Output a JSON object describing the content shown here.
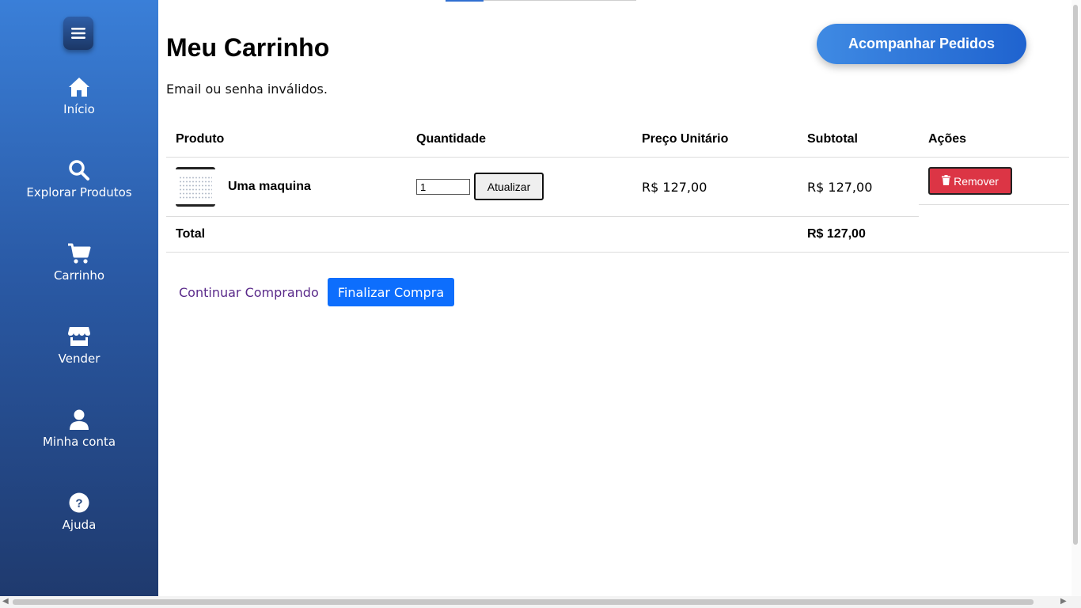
{
  "sidebar": {
    "menu_icon": "hamburger-menu-icon",
    "items": [
      {
        "label": "Início",
        "icon": "home-icon"
      },
      {
        "label": "Explorar Produtos",
        "icon": "search-icon"
      },
      {
        "label": "Carrinho",
        "icon": "cart-icon"
      },
      {
        "label": "Vender",
        "icon": "store-icon"
      },
      {
        "label": "Minha conta",
        "icon": "user-icon"
      },
      {
        "label": "Ajuda",
        "icon": "help-icon"
      }
    ]
  },
  "header": {
    "title": "Meu Carrinho",
    "track_orders_label": "Acompanhar Pedidos",
    "error_message": "Email ou senha inválidos."
  },
  "cart_table": {
    "headers": [
      "Produto",
      "Quantidade",
      "Preço Unitário",
      "Subtotal",
      "Ações"
    ],
    "rows": [
      {
        "product_name": "Uma maquina",
        "quantity": "1",
        "update_label": "Atualizar",
        "unit_price": "R$ 127,00",
        "subtotal": "R$ 127,00",
        "remove_label": "Remover"
      }
    ],
    "total_label": "Total",
    "total_value": "R$ 127,00"
  },
  "actions": {
    "continue_label": "Continuar Comprando",
    "checkout_label": "Finalizar Compra"
  },
  "colors": {
    "accent": "#0d6efd",
    "danger": "#dc3545",
    "sidebar_top": "#3a7fd8",
    "sidebar_bottom": "#1f3a6e"
  }
}
